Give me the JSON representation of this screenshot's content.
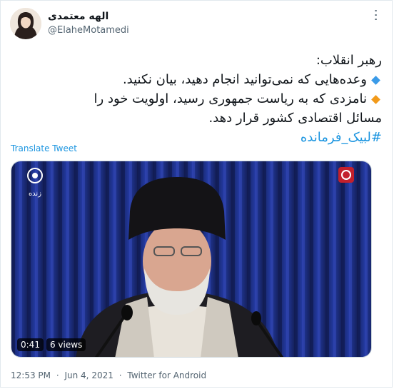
{
  "author": {
    "display_name": "الهه معتمدی",
    "handle": "@ElaheMotamedi"
  },
  "icons": {
    "more": "more-options-icon",
    "avatar": "profile-avatar"
  },
  "tweet": {
    "line1": "رهبر انقلاب:",
    "line2": "وعده‌هایی که نمی‌توانید انجام دهید، بیان نکنید.",
    "line3": "نامزدی که به ریاست جمهوری رسید، اولویت خود را",
    "line4": "مسائل اقتصادی کشور قرار دهد.",
    "hashtag": "#لبیک_فرمانده"
  },
  "translate_label": "Translate Tweet",
  "media": {
    "duration": "0:41",
    "views": "6 views",
    "channel_logo_text": "زنده",
    "curtain_color": "#1a2a78"
  },
  "colors": {
    "link": "#1b95e0",
    "bullet_blue": "#3b9be8",
    "bullet_orange": "#f29a1a"
  },
  "footer": {
    "time": "12:53 PM",
    "sep1": "·",
    "date": "Jun 4, 2021",
    "sep2": "·",
    "source": "Twitter for Android"
  }
}
